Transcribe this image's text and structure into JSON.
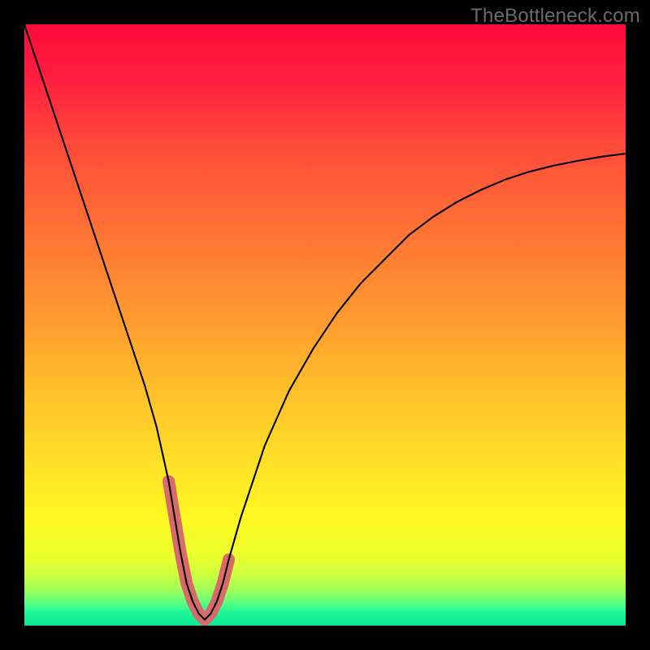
{
  "watermark": {
    "text": "TheBottleneck.com"
  },
  "gradient": {
    "stops": [
      {
        "offset": 0.0,
        "color": "#ff0a3a"
      },
      {
        "offset": 0.09,
        "color": "#ff1f3f"
      },
      {
        "offset": 0.2,
        "color": "#ff4a3a"
      },
      {
        "offset": 0.33,
        "color": "#ff6f35"
      },
      {
        "offset": 0.48,
        "color": "#ff9830"
      },
      {
        "offset": 0.62,
        "color": "#ffc22a"
      },
      {
        "offset": 0.74,
        "color": "#ffe326"
      },
      {
        "offset": 0.82,
        "color": "#fff823"
      },
      {
        "offset": 0.88,
        "color": "#ecff2a"
      },
      {
        "offset": 0.918,
        "color": "#c9ff40"
      },
      {
        "offset": 0.944,
        "color": "#97ff5d"
      },
      {
        "offset": 0.962,
        "color": "#5aff80"
      },
      {
        "offset": 0.978,
        "color": "#20f79a"
      },
      {
        "offset": 1.0,
        "color": "#07e68f"
      }
    ]
  },
  "curve": {
    "stroke": "#000000",
    "stroke_width": 2.1,
    "trough_marker": {
      "stroke": "#d96a6a",
      "stroke_width": 15,
      "linecap": "round"
    }
  },
  "chart_data": {
    "type": "line",
    "title": "",
    "xlabel": "",
    "ylabel": "",
    "xlim": [
      0,
      100
    ],
    "ylim": [
      0,
      100
    ],
    "legend": false,
    "grid": false,
    "series": [
      {
        "name": "bottleneck-curve",
        "x": [
          0,
          2,
          4,
          6,
          8,
          10,
          12,
          14,
          16,
          18,
          20,
          22,
          24,
          25,
          26,
          27,
          28,
          29,
          30,
          31,
          32,
          33,
          34,
          36,
          38,
          40,
          44,
          48,
          52,
          56,
          60,
          64,
          68,
          72,
          76,
          80,
          84,
          88,
          92,
          96,
          100
        ],
        "y": [
          100,
          94,
          88,
          82,
          76,
          70,
          64,
          58,
          52,
          46,
          40,
          33,
          24,
          18,
          12,
          7,
          4,
          2,
          1,
          2,
          4,
          7,
          11,
          18,
          24,
          30,
          39,
          46,
          52,
          57,
          61,
          65,
          68,
          70.5,
          72.5,
          74.2,
          75.5,
          76.5,
          77.3,
          78,
          78.5
        ]
      }
    ],
    "annotations": [
      {
        "type": "trough-marker",
        "x_range": [
          24,
          35
        ],
        "note": "red rounded V marker near minimum"
      }
    ]
  }
}
